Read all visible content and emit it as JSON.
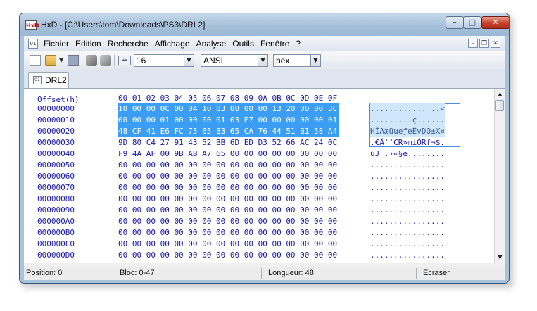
{
  "window": {
    "title": "HxD - [C:\\Users\\tom\\Downloads\\PS3\\DRL2]",
    "app_icon": "hxd-logo",
    "controls": {
      "minimize": "minimize-icon",
      "maximize": "maximize-icon",
      "close": "close-icon"
    }
  },
  "menu": {
    "items": [
      "Fichier",
      "Edition",
      "Recherche",
      "Affichage",
      "Analyse",
      "Outils",
      "Fenêtre",
      "?"
    ]
  },
  "toolbar": {
    "columns_value": "16",
    "charset_value": "ANSI",
    "offset_base_value": "hex"
  },
  "tabs": [
    {
      "label": "DRL2"
    }
  ],
  "hexview": {
    "header_label": "Offset(h)",
    "column_headers": [
      "00",
      "01",
      "02",
      "03",
      "04",
      "05",
      "06",
      "07",
      "08",
      "09",
      "0A",
      "0B",
      "0C",
      "0D",
      "0E",
      "0F"
    ],
    "selection_length": 48,
    "rows": [
      {
        "offset": "00000000",
        "bytes": [
          "10",
          "00",
          "00",
          "0C",
          "00",
          "04",
          "10",
          "03",
          "00",
          "00",
          "00",
          "13",
          "20",
          "00",
          "00",
          "3C"
        ],
        "ascii": "............ ..<"
      },
      {
        "offset": "00000010",
        "bytes": [
          "00",
          "00",
          "00",
          "01",
          "00",
          "00",
          "00",
          "01",
          "03",
          "E7",
          "00",
          "00",
          "00",
          "00",
          "00",
          "01"
        ],
        "ascii": ".........ç......"
      },
      {
        "offset": "00000020",
        "bytes": [
          "48",
          "CF",
          "41",
          "E6",
          "FC",
          "75",
          "65",
          "83",
          "65",
          "CA",
          "76",
          "44",
          "51",
          "B1",
          "58",
          "A4"
        ],
        "ascii": "HÏAæüueƒeÊvDQ±X¤"
      },
      {
        "offset": "00000030",
        "bytes": [
          "9D",
          "80",
          "C4",
          "27",
          "91",
          "43",
          "52",
          "BB",
          "6D",
          "ED",
          "D3",
          "52",
          "66",
          "AC",
          "24",
          "0C"
        ],
        "ascii": ".€Ä'‘CR»míÓRf¬$."
      },
      {
        "offset": "00000040",
        "bytes": [
          "F9",
          "4A",
          "AF",
          "00",
          "9B",
          "AB",
          "A7",
          "65",
          "00",
          "00",
          "00",
          "00",
          "00",
          "00",
          "00",
          "00"
        ],
        "ascii": "ùJ¯.›«§e........"
      },
      {
        "offset": "00000050",
        "bytes": [
          "00",
          "00",
          "00",
          "00",
          "00",
          "00",
          "00",
          "00",
          "00",
          "00",
          "00",
          "00",
          "00",
          "00",
          "00",
          "00"
        ],
        "ascii": "................"
      },
      {
        "offset": "00000060",
        "bytes": [
          "00",
          "00",
          "00",
          "00",
          "00",
          "00",
          "00",
          "00",
          "00",
          "00",
          "00",
          "00",
          "00",
          "00",
          "00",
          "00"
        ],
        "ascii": "................"
      },
      {
        "offset": "00000070",
        "bytes": [
          "00",
          "00",
          "00",
          "00",
          "00",
          "00",
          "00",
          "00",
          "00",
          "00",
          "00",
          "00",
          "00",
          "00",
          "00",
          "00"
        ],
        "ascii": "................"
      },
      {
        "offset": "00000080",
        "bytes": [
          "00",
          "00",
          "00",
          "00",
          "00",
          "00",
          "00",
          "00",
          "00",
          "00",
          "00",
          "00",
          "00",
          "00",
          "00",
          "00"
        ],
        "ascii": "................"
      },
      {
        "offset": "00000090",
        "bytes": [
          "00",
          "00",
          "00",
          "00",
          "00",
          "00",
          "00",
          "00",
          "00",
          "00",
          "00",
          "00",
          "00",
          "00",
          "00",
          "00"
        ],
        "ascii": "................"
      },
      {
        "offset": "000000A0",
        "bytes": [
          "00",
          "00",
          "00",
          "00",
          "00",
          "00",
          "00",
          "00",
          "00",
          "00",
          "00",
          "00",
          "00",
          "00",
          "00",
          "00"
        ],
        "ascii": "................"
      },
      {
        "offset": "000000B0",
        "bytes": [
          "00",
          "00",
          "00",
          "00",
          "00",
          "00",
          "00",
          "00",
          "00",
          "00",
          "00",
          "00",
          "00",
          "00",
          "00",
          "00"
        ],
        "ascii": "................"
      },
      {
        "offset": "000000C0",
        "bytes": [
          "00",
          "00",
          "00",
          "00",
          "00",
          "00",
          "00",
          "00",
          "00",
          "00",
          "00",
          "00",
          "00",
          "00",
          "00",
          "00"
        ],
        "ascii": "................"
      },
      {
        "offset": "000000D0",
        "bytes": [
          "00",
          "00",
          "00",
          "00",
          "00",
          "00",
          "00",
          "00",
          "00",
          "00",
          "00",
          "00",
          "00",
          "00",
          "00",
          "00"
        ],
        "ascii": "................"
      }
    ]
  },
  "status": {
    "position": "Position: 0",
    "block": "Bloc: 0-47",
    "length": "Longueur: 48",
    "mode": "Ecraser"
  },
  "colors": {
    "selection": "#3c9df5",
    "ascii_selection": "#cfe6fb",
    "hex_text": "#1a1aa6"
  }
}
